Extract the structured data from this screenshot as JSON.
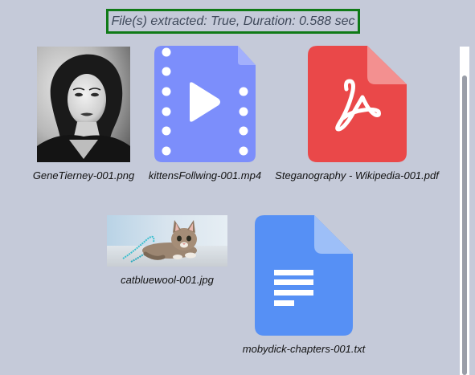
{
  "status": {
    "text": "File(s) extracted: True, Duration: 0.588 sec",
    "border_color": "#0f7a17"
  },
  "files": [
    {
      "name": "GeneTierney-001.png",
      "kind": "image-portrait"
    },
    {
      "name": "kittensFollwing-001.mp4",
      "kind": "video-file-icon",
      "color": "#7c8efb"
    },
    {
      "name": "Steganography - Wikipedia-001.pdf",
      "kind": "pdf-file-icon",
      "color": "#ea4849"
    },
    {
      "name": "catbluewool-001.jpg",
      "kind": "image-photo"
    },
    {
      "name": "mobydick-chapters-001.txt",
      "kind": "text-file-icon",
      "color": "#5690f5"
    }
  ],
  "colors": {
    "background": "#c5cad9"
  }
}
